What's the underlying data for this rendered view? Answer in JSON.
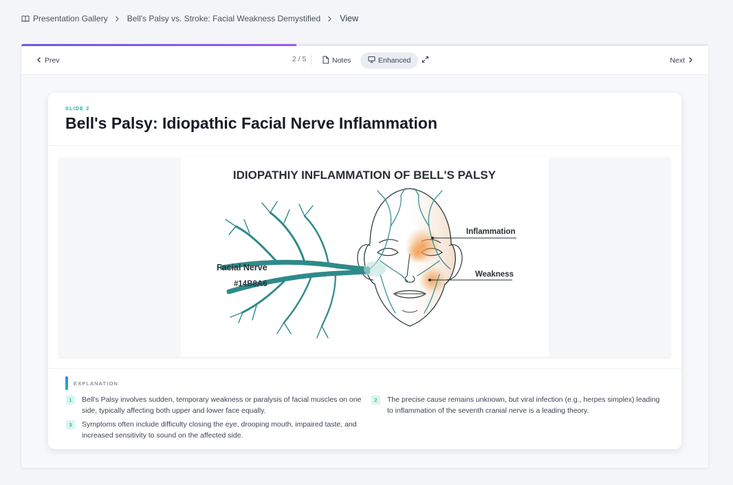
{
  "breadcrumb": {
    "gallery": "Presentation Gallery",
    "presentation": "Bell's Palsy vs. Stroke: Facial Weakness Demystified",
    "current": "View"
  },
  "toolbar": {
    "prev_label": "Prev",
    "next_label": "Next",
    "counter": "2 / 5",
    "notes_label": "Notes",
    "enhanced_label": "Enhanced",
    "progress_fraction": 0.4
  },
  "slide": {
    "label": "SLIDE 2",
    "title": "Bell's Palsy: Idiopathic Facial Nerve Inflammation",
    "image": {
      "heading": "IDIOPATHIY INFLAMMATION OF BELL'S PALSY",
      "label_nerve": "Facial Nerve",
      "label_color": "#14B8A6",
      "label_inflammation": "Inflammation",
      "label_weakness": "Weakness"
    }
  },
  "explanation": {
    "heading": "EXPLANATION",
    "points": [
      {
        "num": "1",
        "text": "Bell's Palsy involves sudden, temporary weakness or paralysis of facial muscles on one side, typically affecting both upper and lower face equally."
      },
      {
        "num": "2",
        "text": "The precise cause remains unknown, but viral infection (e.g., herpes simplex) leading to inflammation of the seventh cranial nerve is a leading theory."
      },
      {
        "num": "3",
        "text": "Symptoms often include difficulty closing the eye, drooping mouth, impaired taste, and increased sensitivity to sound on the affected side."
      }
    ]
  },
  "colors": {
    "accent_teal": "#14B8A6",
    "progress_purple": "#9b5de5",
    "nerve_teal": "#2f8a8a",
    "inflammation_orange": "#f0a25a"
  }
}
